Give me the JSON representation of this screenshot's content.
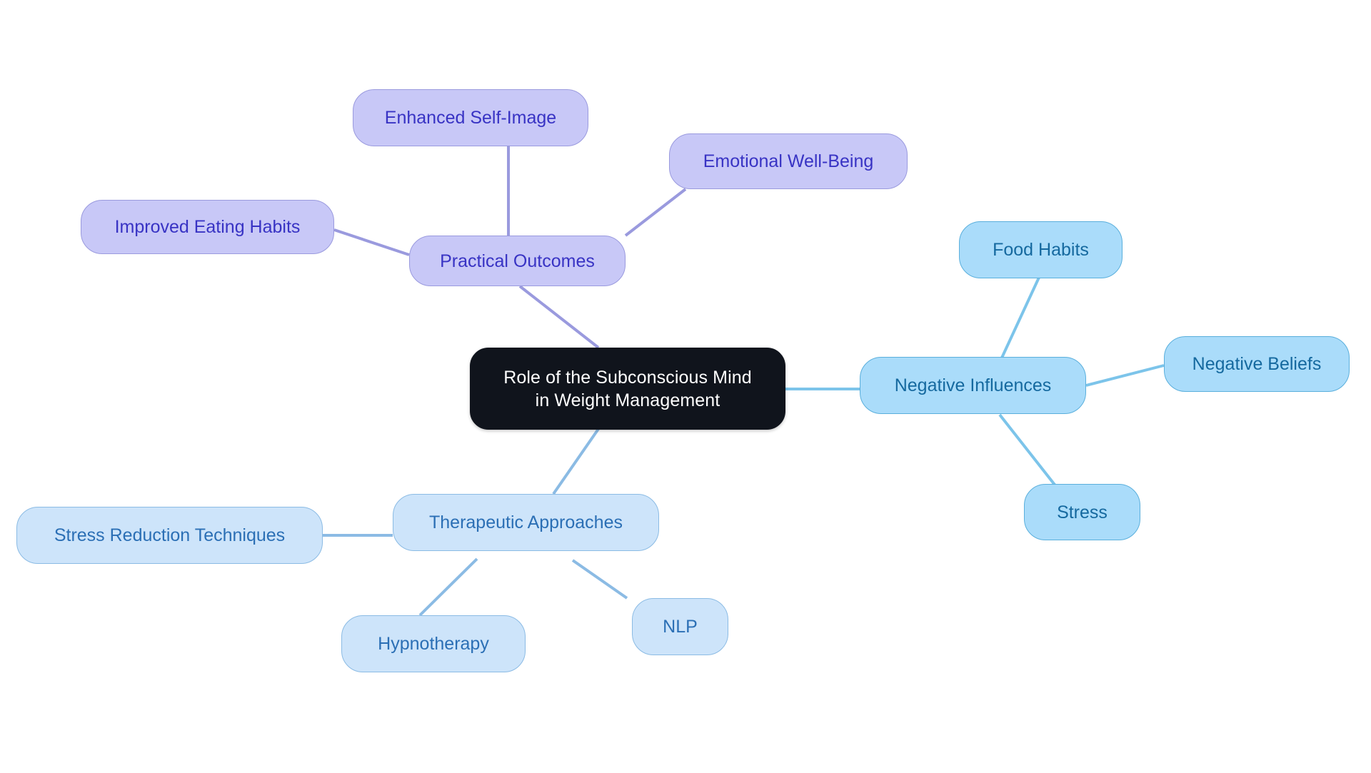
{
  "diagram": {
    "type": "mind-map",
    "background_color": "#ffffff",
    "root": {
      "id": "root",
      "label": "Role of the Subconscious Mind\nin Weight Management",
      "fill": "#10141c",
      "text_color": "#ffffff"
    },
    "branches": [
      {
        "id": "practical-outcomes",
        "label": "Practical Outcomes",
        "fill": "#c8c8f7",
        "border": "#9a9ade",
        "text_color": "#3833c4",
        "edge_color": "#9a9ade",
        "children": [
          {
            "id": "enhanced-self-image",
            "label": "Enhanced Self-Image"
          },
          {
            "id": "emotional-well-being",
            "label": "Emotional Well-Being"
          },
          {
            "id": "improved-eating-habits",
            "label": "Improved Eating Habits"
          }
        ]
      },
      {
        "id": "negative-influences",
        "label": "Negative Influences",
        "fill": "#aadcfa",
        "border": "#5aafdc",
        "text_color": "#15699f",
        "edge_color": "#7cc4ea",
        "children": [
          {
            "id": "food-habits",
            "label": "Food Habits"
          },
          {
            "id": "negative-beliefs",
            "label": "Negative Beliefs"
          },
          {
            "id": "stress",
            "label": "Stress"
          }
        ]
      },
      {
        "id": "therapeutic-approaches",
        "label": "Therapeutic Approaches",
        "fill": "#cde4fa",
        "border": "#8bbbe4",
        "text_color": "#2b6fb5",
        "edge_color": "#8bbbe4",
        "children": [
          {
            "id": "stress-reduction-techniques",
            "label": "Stress Reduction Techniques"
          },
          {
            "id": "hypnotherapy",
            "label": "Hypnotherapy"
          },
          {
            "id": "nlp",
            "label": "NLP"
          }
        ]
      }
    ]
  }
}
